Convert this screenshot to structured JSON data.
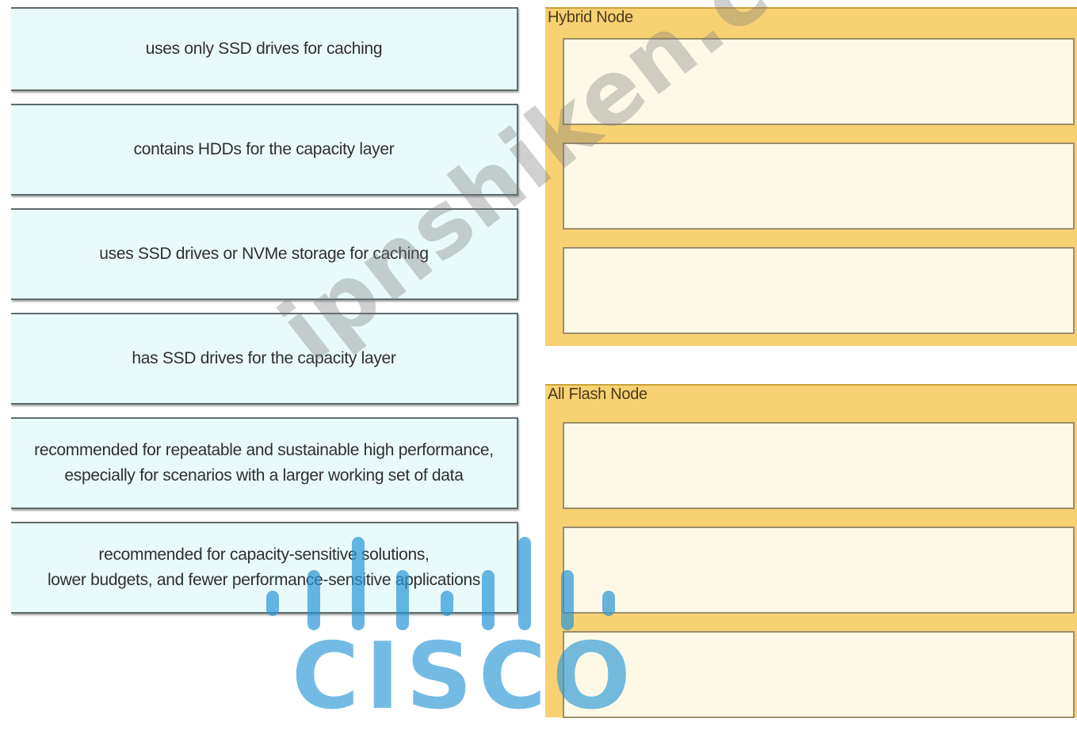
{
  "drag_items": [
    {
      "label": "uses only SSD drives for caching"
    },
    {
      "label": "contains HDDs for the capacity layer"
    },
    {
      "label": "uses SSD drives or NVMe storage for caching"
    },
    {
      "label": "has SSD drives for the capacity layer"
    },
    {
      "label": "recommended for repeatable and sustainable high performance,\nespecially for scenarios with a larger working set of data"
    },
    {
      "label": "recommended for capacity-sensitive solutions,\nlower budgets, and fewer performance-sensitive applications"
    }
  ],
  "targets": [
    {
      "label": "Hybrid Node"
    },
    {
      "label": "All Flash Node"
    }
  ],
  "watermark": {
    "text": "ipnshiken.com",
    "logo_word": "CISCO"
  }
}
